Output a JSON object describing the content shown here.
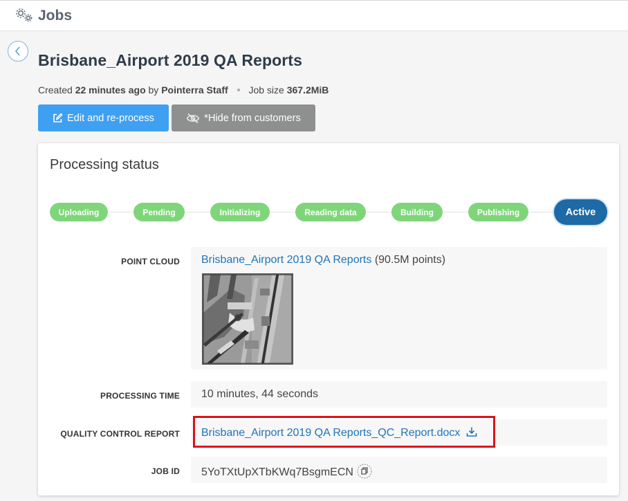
{
  "header": {
    "title": "Jobs",
    "icon": "gears-icon"
  },
  "job": {
    "title": "Brisbane_Airport 2019 QA Reports",
    "created_prefix": "Created",
    "created_ago": "22 minutes ago",
    "by_word": "by",
    "created_by": "Pointerra Staff",
    "size_label": "Job size",
    "size_value": "367.2MiB"
  },
  "actions": {
    "edit_label": "Edit and re-process",
    "hide_label": "*Hide from customers"
  },
  "status": {
    "title": "Processing status",
    "steps": [
      "Uploading",
      "Pending",
      "Initializing",
      "Reading data",
      "Building",
      "Publishing",
      "Active"
    ],
    "active_step": "Active"
  },
  "details": {
    "point_cloud_label": "POINT CLOUD",
    "point_cloud_link": "Brisbane_Airport 2019 QA Reports",
    "point_cloud_count": "(90.5M points)",
    "processing_time_label": "PROCESSING TIME",
    "processing_time_value": "10 minutes, 44 seconds",
    "qc_report_label": "QUALITY CONTROL REPORT",
    "qc_report_link": "Brisbane_Airport 2019 QA Reports_QC_Report.docx",
    "job_id_label": "JOB ID",
    "job_id_value": "5YoTXtUpXTbKWq7BsgmECN"
  },
  "colors": {
    "step_done": "#7fd67a",
    "step_active": "#1d6aa6",
    "link": "#1f74b8",
    "highlight": "#e0101a"
  }
}
